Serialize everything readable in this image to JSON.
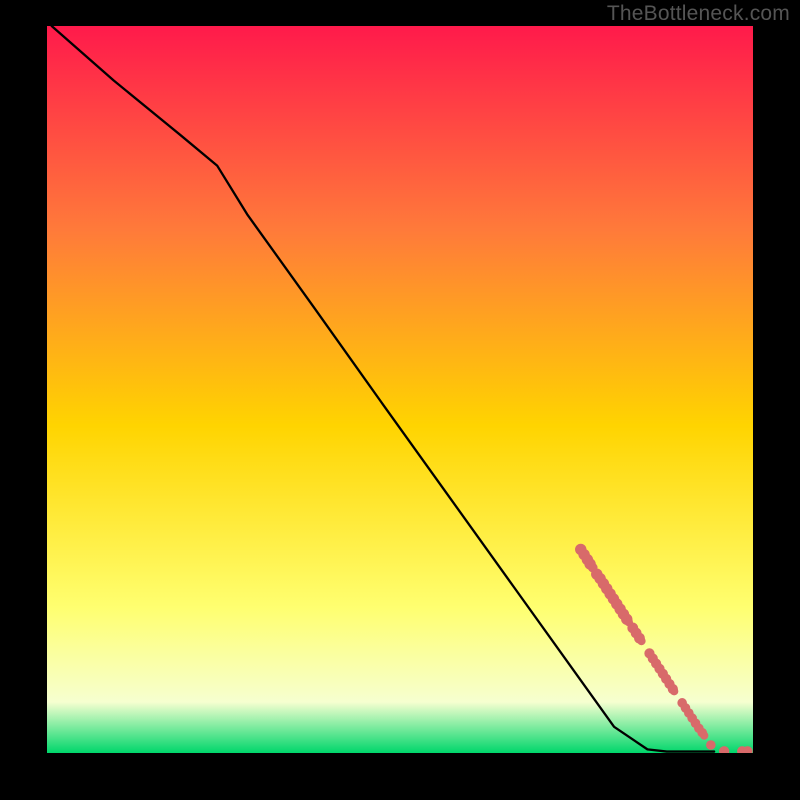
{
  "attribution": "TheBottleneck.com",
  "colors": {
    "bg": "#000000",
    "attribution_text": "#555555",
    "gradient_top": "#ff1a4b",
    "gradient_mid_upper": "#ff7a3a",
    "gradient_mid": "#ffd400",
    "gradient_lower": "#ffff70",
    "gradient_lowest": "#f6ffd0",
    "gradient_bottom": "#00d66b",
    "line": "#000000",
    "marker": "#d86a6a"
  },
  "chart_data": {
    "type": "line",
    "title": "",
    "xlabel": "",
    "ylabel": "",
    "xlim": [
      0,
      100
    ],
    "ylim": [
      0,
      100
    ],
    "grid": false,
    "legend": false,
    "series": [
      {
        "name": "curve",
        "x": [
          0.7,
          10,
          20,
          25.5,
          30,
          40,
          50,
          60,
          70,
          80,
          85,
          90,
          92.9,
          96,
          100
        ],
        "y": [
          100,
          92.5,
          85,
          80.8,
          74.1,
          61.3,
          48.4,
          35.6,
          22.8,
          10,
          3.6,
          0.5,
          0.2,
          0.2,
          0.2
        ]
      }
    ],
    "markers": [
      {
        "x": 80.0,
        "y": 28.0,
        "r": 0.95
      },
      {
        "x": 80.5,
        "y": 27.3,
        "r": 0.95
      },
      {
        "x": 81.0,
        "y": 26.6,
        "r": 0.95
      },
      {
        "x": 81.4,
        "y": 26.0,
        "r": 0.95
      },
      {
        "x": 81.8,
        "y": 25.5,
        "r": 0.8
      },
      {
        "x": 82.4,
        "y": 24.6,
        "r": 0.95
      },
      {
        "x": 82.9,
        "y": 24.0,
        "r": 0.95
      },
      {
        "x": 83.4,
        "y": 23.3,
        "r": 0.95
      },
      {
        "x": 83.9,
        "y": 22.6,
        "r": 0.95
      },
      {
        "x": 84.4,
        "y": 21.9,
        "r": 0.95
      },
      {
        "x": 84.9,
        "y": 21.2,
        "r": 0.95
      },
      {
        "x": 85.4,
        "y": 20.5,
        "r": 0.95
      },
      {
        "x": 85.9,
        "y": 19.8,
        "r": 0.95
      },
      {
        "x": 86.4,
        "y": 19.1,
        "r": 0.95
      },
      {
        "x": 86.9,
        "y": 18.4,
        "r": 0.95
      },
      {
        "x": 87.2,
        "y": 18.0,
        "r": 0.7
      },
      {
        "x": 87.8,
        "y": 17.2,
        "r": 0.9
      },
      {
        "x": 88.3,
        "y": 16.5,
        "r": 0.9
      },
      {
        "x": 88.8,
        "y": 15.8,
        "r": 0.9
      },
      {
        "x": 89.1,
        "y": 15.4,
        "r": 0.7
      },
      {
        "x": 90.3,
        "y": 13.7,
        "r": 0.85
      },
      {
        "x": 90.8,
        "y": 13.0,
        "r": 0.85
      },
      {
        "x": 91.3,
        "y": 12.3,
        "r": 0.85
      },
      {
        "x": 91.8,
        "y": 11.6,
        "r": 0.85
      },
      {
        "x": 92.3,
        "y": 10.9,
        "r": 0.85
      },
      {
        "x": 92.8,
        "y": 10.2,
        "r": 0.85
      },
      {
        "x": 93.3,
        "y": 9.5,
        "r": 0.85
      },
      {
        "x": 93.8,
        "y": 8.8,
        "r": 0.85
      },
      {
        "x": 94.0,
        "y": 8.5,
        "r": 0.7
      },
      {
        "x": 95.2,
        "y": 6.9,
        "r": 0.8
      },
      {
        "x": 95.7,
        "y": 6.2,
        "r": 0.8
      },
      {
        "x": 96.2,
        "y": 5.5,
        "r": 0.8
      },
      {
        "x": 96.7,
        "y": 4.8,
        "r": 0.8
      },
      {
        "x": 97.2,
        "y": 4.1,
        "r": 0.8
      },
      {
        "x": 97.7,
        "y": 3.4,
        "r": 0.8
      },
      {
        "x": 98.2,
        "y": 2.8,
        "r": 0.8
      },
      {
        "x": 98.5,
        "y": 2.4,
        "r": 0.7
      },
      {
        "x": 99.5,
        "y": 1.1,
        "r": 0.8
      },
      {
        "x": 101.5,
        "y": 0.25,
        "r": 0.85
      },
      {
        "x": 104.2,
        "y": 0.25,
        "r": 0.85
      },
      {
        "x": 105.0,
        "y": 0.25,
        "r": 0.85
      }
    ]
  }
}
